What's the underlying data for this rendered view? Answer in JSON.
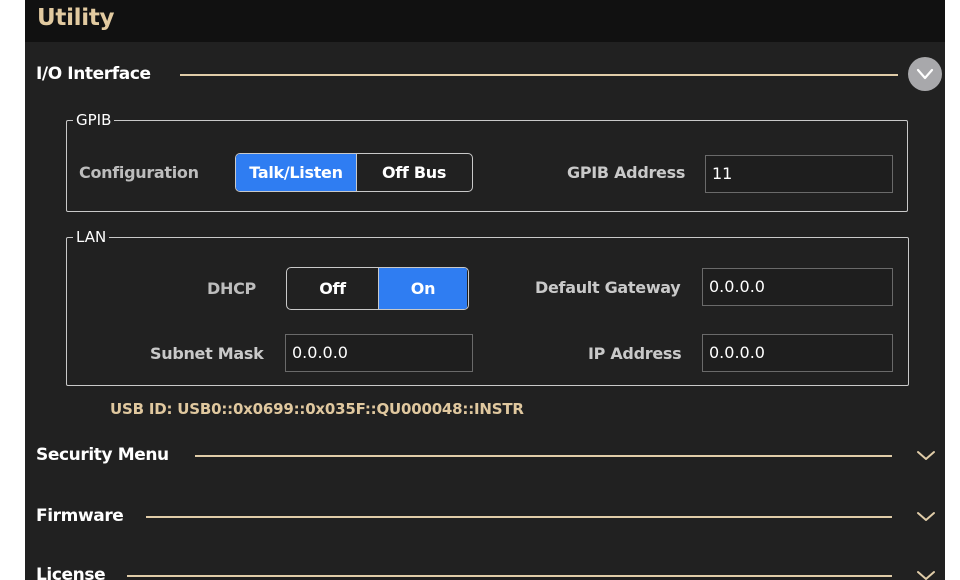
{
  "header": {
    "title": "Utility"
  },
  "io_interface": {
    "title": "I/O Interface",
    "expanded": true,
    "gpib": {
      "legend": "GPIB",
      "configuration_label": "Configuration",
      "options": [
        "Talk/Listen",
        "Off Bus"
      ],
      "selected": "Talk/Listen",
      "address_label": "GPIB Address",
      "address_value": "11"
    },
    "lan": {
      "legend": "LAN",
      "dhcp_label": "DHCP",
      "dhcp_options": [
        "Off",
        "On"
      ],
      "dhcp_selected": "On",
      "default_gateway_label": "Default Gateway",
      "default_gateway_value": "0.0.0.0",
      "subnet_mask_label": "Subnet Mask",
      "subnet_mask_value": "0.0.0.0",
      "ip_address_label": "IP Address",
      "ip_address_value": "0.0.0.0"
    },
    "usb_id": "USB ID: USB0::0x0699::0x035F::QU000048::INSTR"
  },
  "sections": [
    {
      "title": "Security Menu",
      "expanded": false
    },
    {
      "title": "Firmware",
      "expanded": false
    },
    {
      "title": "License",
      "expanded": false
    }
  ],
  "colors": {
    "accent": "#2f7df2",
    "header_text": "#e2caa0",
    "divider": "#e0cca8",
    "usb_text": "#e0c89f",
    "panel_bg": "#212121"
  },
  "icons": {
    "expand_collapse": "chevron-down-icon"
  }
}
